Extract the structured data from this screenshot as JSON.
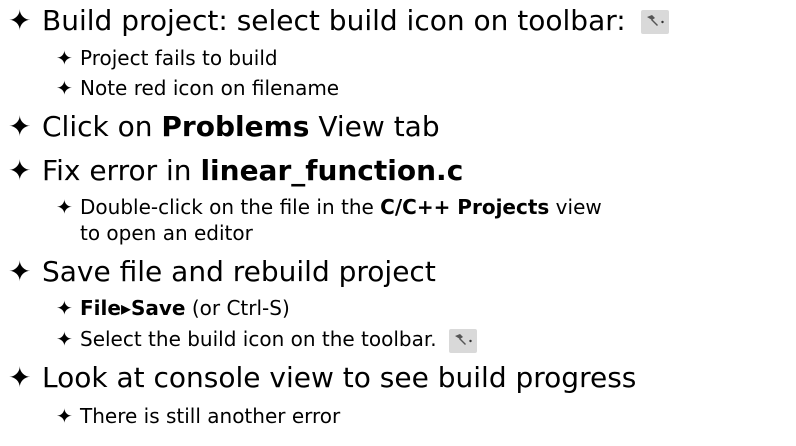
{
  "bullet_glyph": "✦",
  "items": [
    {
      "text": "Build project: select build icon on toolbar:",
      "icon": "hammer-build-icon",
      "subitems": [
        {
          "text": "Project fails to build"
        },
        {
          "text": "Note red icon on filename"
        }
      ]
    },
    {
      "pre": "Click on ",
      "bold": "Problems",
      "post": " View tab"
    },
    {
      "pre": "Fix error in ",
      "bold": "linear_function.c",
      "subitems": [
        {
          "pre": "Double-click on the file in the ",
          "bold": "C/C++ Projects",
          "post": " view",
          "continuation": "to open an editor"
        }
      ]
    },
    {
      "text": "Save file and rebuild project",
      "subitems": [
        {
          "bold": "File▸Save",
          "post": " (or Ctrl-S)"
        },
        {
          "text": "Select the build icon on the toolbar.",
          "icon": "hammer-build-icon"
        }
      ]
    },
    {
      "text": "Look at console view to see build progress",
      "subitems": [
        {
          "text": "There is still another error"
        }
      ]
    }
  ],
  "colors": {
    "text": "#000000",
    "background": "#ffffff",
    "icon_bg": "#d9d9d9"
  }
}
